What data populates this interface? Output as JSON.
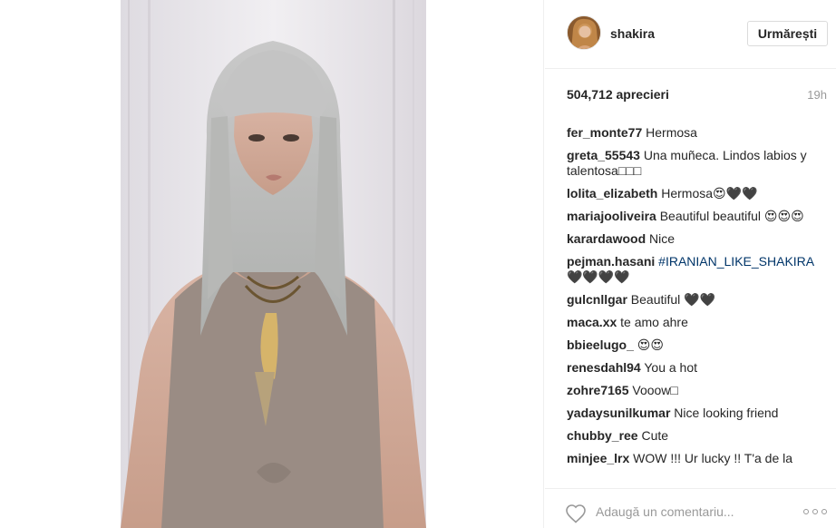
{
  "post": {
    "username": "shakira",
    "follow_label": "Urmărești",
    "likes": "504,712 aprecieri",
    "time": "19h"
  },
  "comments": [
    {
      "user": "fer_monte77",
      "text": "Hermosa"
    },
    {
      "user": "greta_55543",
      "text": "Una muñeca. Lindos labios y talentosa□□□"
    },
    {
      "user": "lolita_elizabeth",
      "text": "Hermosa😍🖤🖤"
    },
    {
      "user": "mariajooliveira",
      "text": "Beautiful beautiful 😍😍😍"
    },
    {
      "user": "karardawood",
      "text": "Nice"
    },
    {
      "user": "pejman.hasani",
      "text": "",
      "hashtag": "#IRANIAN_LIKE_SHAKIRA",
      "after": " 🖤🖤🖤🖤"
    },
    {
      "user": "gulcnllgar",
      "text": "Beautiful 🖤🖤"
    },
    {
      "user": "maca.xx",
      "text": "te amo ahre"
    },
    {
      "user": "bbieelugo_",
      "text": "😍😍"
    },
    {
      "user": "renesdahl94",
      "text": "You a hot"
    },
    {
      "user": "zohre7165",
      "text": "Vooow□"
    },
    {
      "user": "yadaysunilkumar",
      "text": "Nice looking friend"
    },
    {
      "user": "chubby_ree",
      "text": "Cute"
    },
    {
      "user": "minjee_lrx",
      "text": "WOW !!! Ur lucky !! T'a de la"
    }
  ],
  "footer": {
    "comment_placeholder": "Adaugă un comentariu...",
    "like_icon": "heart-outline-icon",
    "more_icon": "more-options-icon"
  },
  "colors": {
    "text": "#262626",
    "muted": "#999999",
    "hashtag": "#003569",
    "border": "#efefef"
  }
}
